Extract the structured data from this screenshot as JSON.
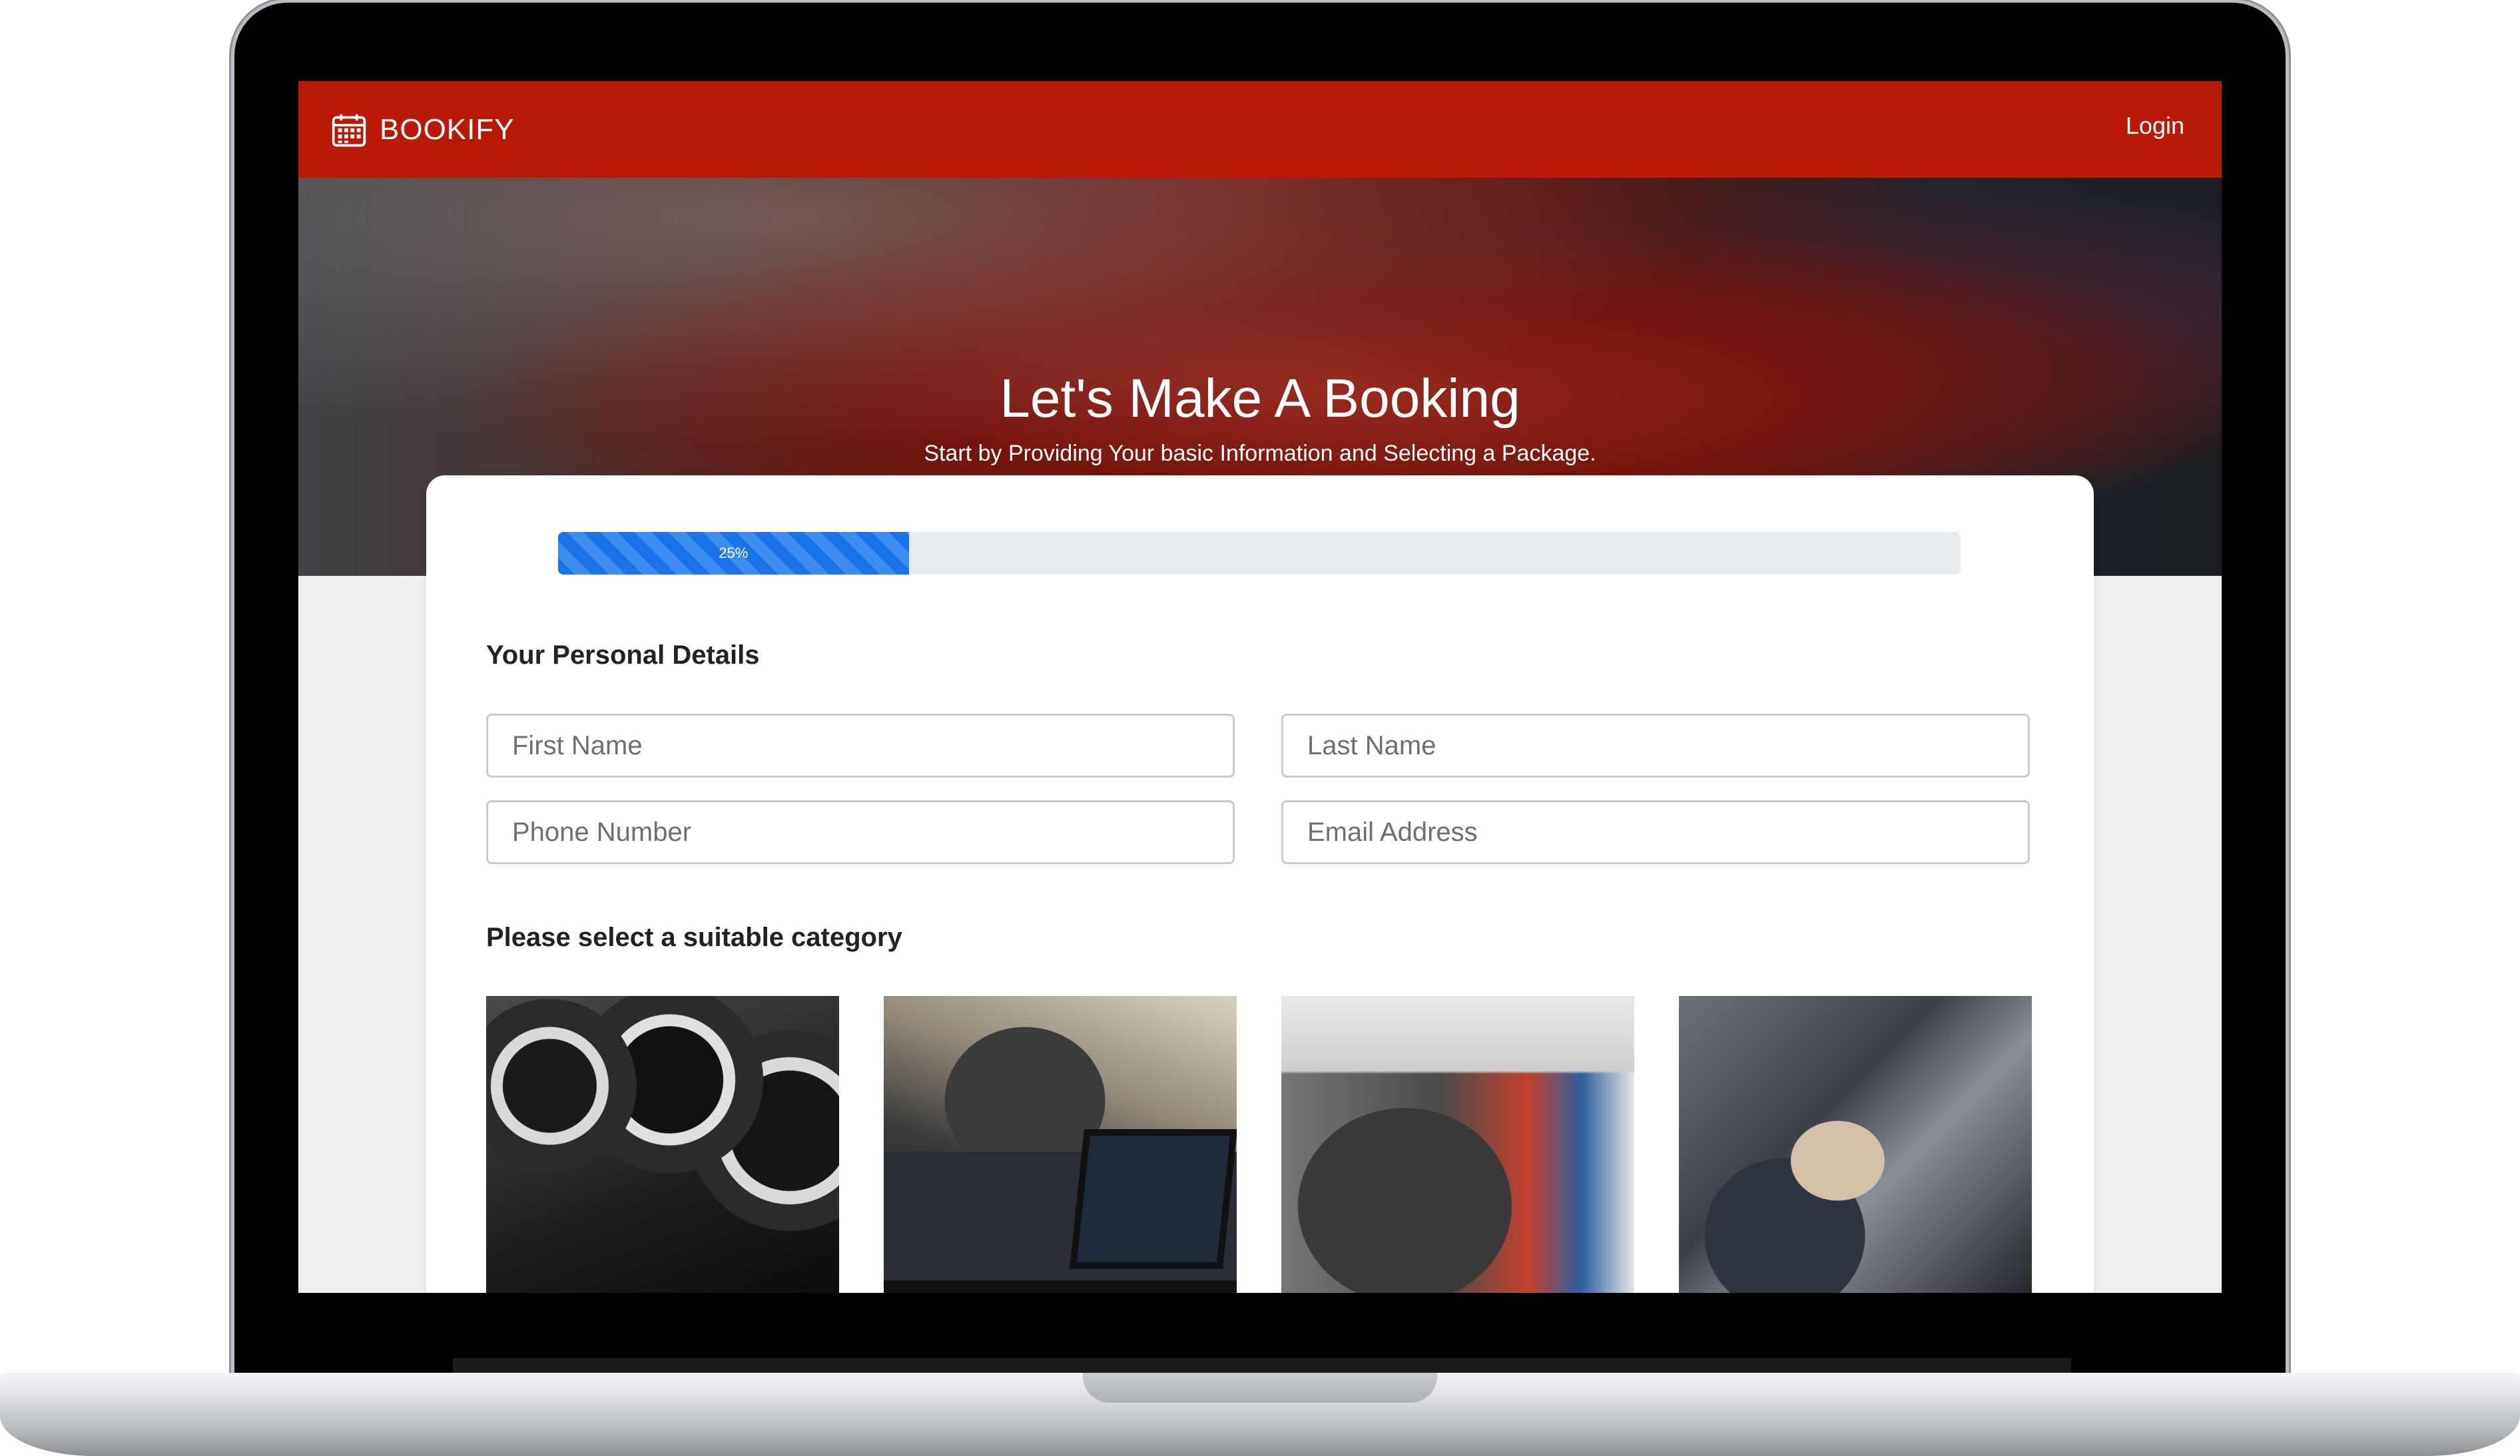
{
  "navbar": {
    "brand": "BOOKIFY",
    "brand_icon": "calendar-icon",
    "login_label": "Login",
    "background": "#b81a06"
  },
  "hero": {
    "title": "Let's Make A Booking",
    "subtitle": "Start by Providing Your basic Information and Selecting a Package."
  },
  "progress": {
    "value_percent": 25,
    "label": "25%",
    "color": "#1a73e8"
  },
  "personal_details": {
    "heading": "Your Personal Details",
    "fields": {
      "first_name": {
        "placeholder": "First Name",
        "value": ""
      },
      "last_name": {
        "placeholder": "Last Name",
        "value": ""
      },
      "phone": {
        "placeholder": "Phone Number",
        "value": ""
      },
      "email": {
        "placeholder": "Email Address",
        "value": ""
      }
    }
  },
  "category_section": {
    "heading": "Please select a suitable category",
    "categories": [
      {
        "image": "car-air-vents-photo"
      },
      {
        "image": "car-diagnostics-laptop-photo"
      },
      {
        "image": "engine-bay-multimeter-photo"
      },
      {
        "image": "engine-wrench-repair-photo"
      }
    ]
  }
}
